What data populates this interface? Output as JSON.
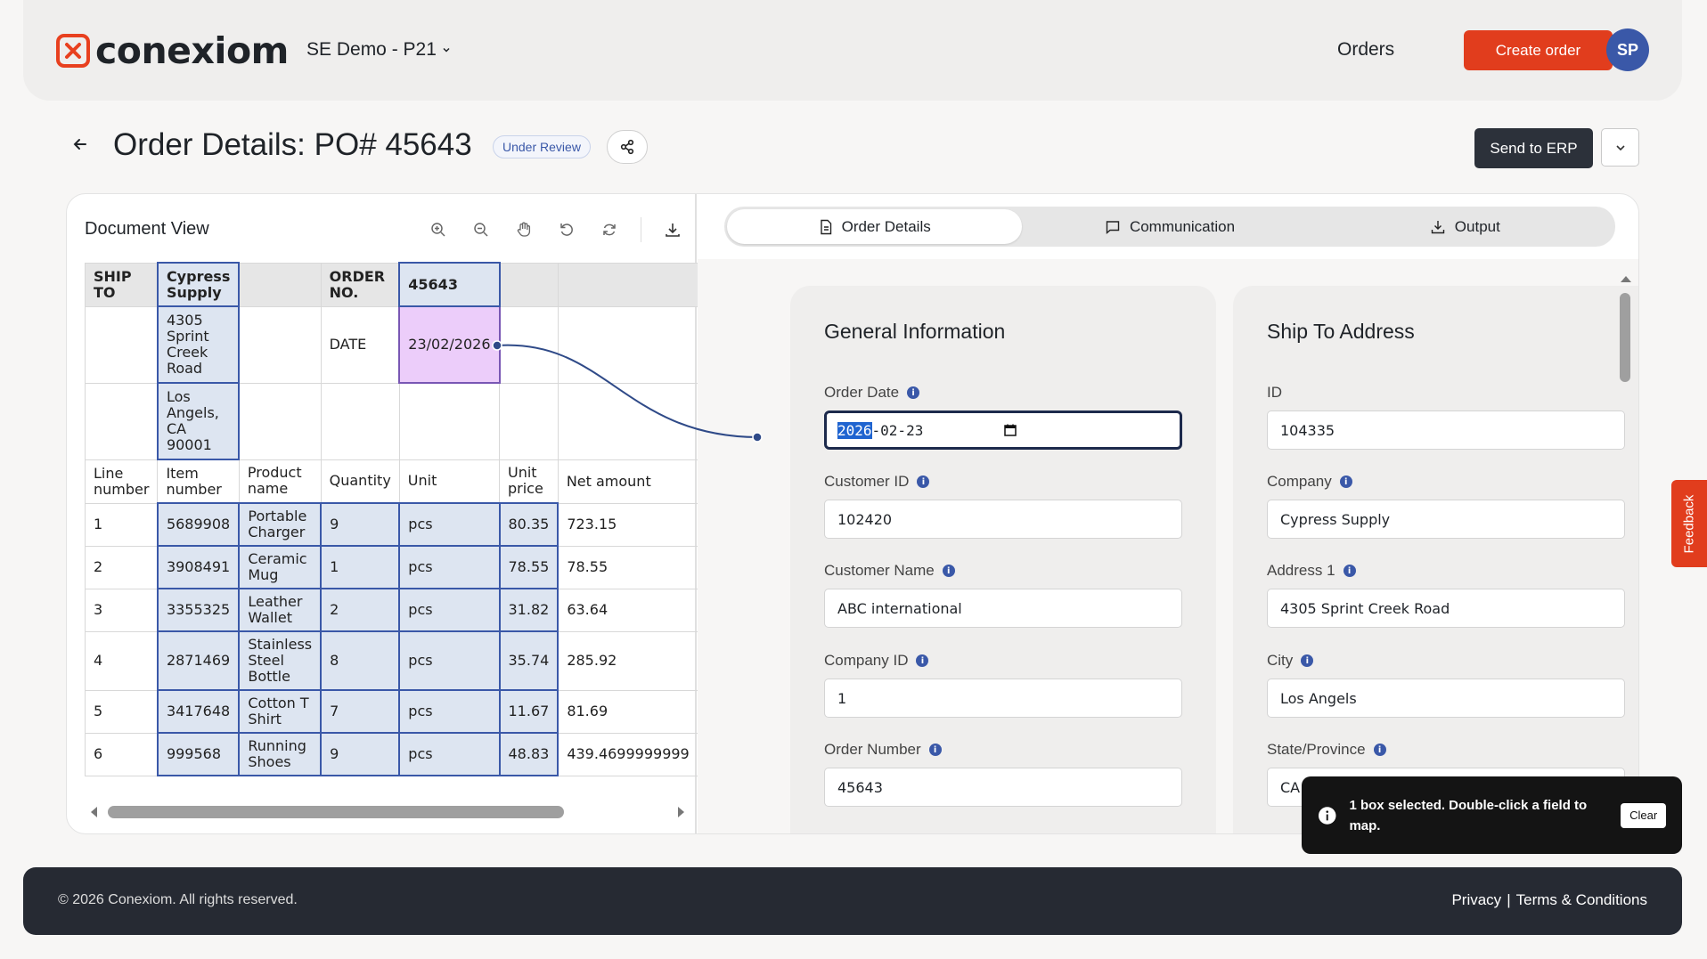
{
  "header": {
    "logo_text": "conexiom",
    "workspace": "SE Demo - P21",
    "nav_orders": "Orders",
    "create_order": "Create order",
    "avatar_initials": "SP"
  },
  "title_row": {
    "title": "Order Details: PO# 45643",
    "status_badge": "Under Review",
    "send_to_erp": "Send to ERP"
  },
  "document_view": {
    "title": "Document View",
    "ship_to_label": "SHIP TO",
    "ship_to_name": "Cypress Supply",
    "ship_to_address": "4305 Sprint Creek Road",
    "ship_to_city": "Los Angels, CA 90001",
    "order_no_label": "ORDER NO.",
    "order_no_value": "45643",
    "date_label": "DATE",
    "date_value": "23/02/2026",
    "columns": [
      "Line number",
      "Item number",
      "Product name",
      "Quantity",
      "Unit",
      "Unit price",
      "Net amount"
    ],
    "rows": [
      [
        "1",
        "5689908",
        "Portable Charger",
        "9",
        "pcs",
        "80.35",
        "723.15"
      ],
      [
        "2",
        "3908491",
        "Ceramic Mug",
        "1",
        "pcs",
        "78.55",
        "78.55"
      ],
      [
        "3",
        "3355325",
        "Leather Wallet",
        "2",
        "pcs",
        "31.82",
        "63.64"
      ],
      [
        "4",
        "2871469",
        "Stainless Steel Bottle",
        "8",
        "pcs",
        "35.74",
        "285.92"
      ],
      [
        "5",
        "3417648",
        "Cotton T Shirt",
        "7",
        "pcs",
        "11.67",
        "81.69"
      ],
      [
        "6",
        "999568",
        "Running Shoes",
        "9",
        "pcs",
        "48.83",
        "439.4699999999"
      ]
    ]
  },
  "tabs": {
    "order_details": "Order Details",
    "communication": "Communication",
    "output": "Output"
  },
  "general_info": {
    "title": "General Information",
    "order_date_label": "Order Date",
    "order_date_year": "2026",
    "order_date_rest": "-02-23",
    "customer_id_label": "Customer ID",
    "customer_id": "102420",
    "customer_name_label": "Customer Name",
    "customer_name": "ABC international",
    "company_id_label": "Company ID",
    "company_id": "1",
    "order_number_label": "Order Number",
    "order_number": "45643"
  },
  "ship_to": {
    "title": "Ship To Address",
    "id_label": "ID",
    "id": "104335",
    "company_label": "Company",
    "company": "Cypress Supply",
    "address1_label": "Address 1",
    "address1": "4305 Sprint Creek Road",
    "city_label": "City",
    "city": "Los Angels",
    "state_label": "State/Province",
    "state": "CA"
  },
  "toast": {
    "message": "1 box selected. Double-click a field to map.",
    "clear": "Clear"
  },
  "feedback": "Feedback",
  "footer": {
    "copyright": "© 2026 Conexiom. All rights reserved.",
    "privacy": "Privacy",
    "separator": "|",
    "terms": "Terms & Conditions"
  },
  "colors": {
    "brand": "#e13d1d",
    "accent": "#3a58a8",
    "dark": "#2c313a"
  }
}
